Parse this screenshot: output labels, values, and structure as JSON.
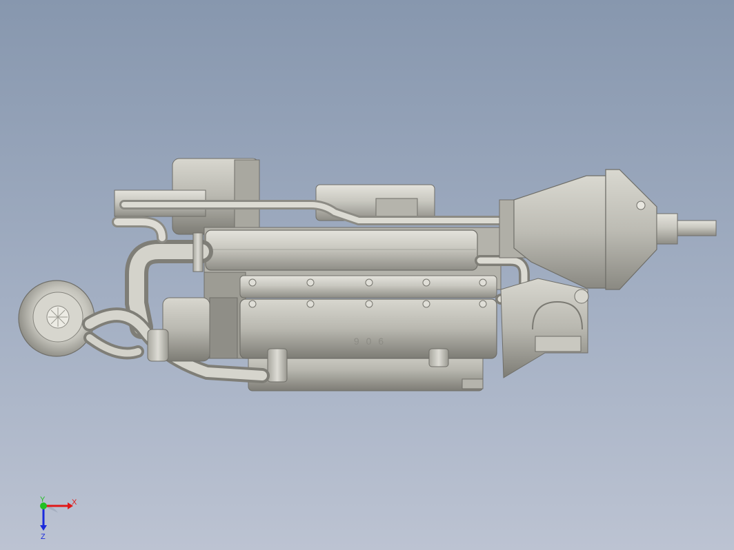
{
  "viewport": {
    "background_top": "#8797ae",
    "background_bottom": "#bcc3d2"
  },
  "model": {
    "casting_marking": "9 0 6",
    "material_color": "#c9c8c0",
    "shadow_color": "#7f7e77"
  },
  "triad": {
    "x_label": "X",
    "y_label": "Y",
    "z_label": "Z",
    "x_color": "#e01818",
    "y_color": "#22c022",
    "z_color": "#1a2adc"
  }
}
